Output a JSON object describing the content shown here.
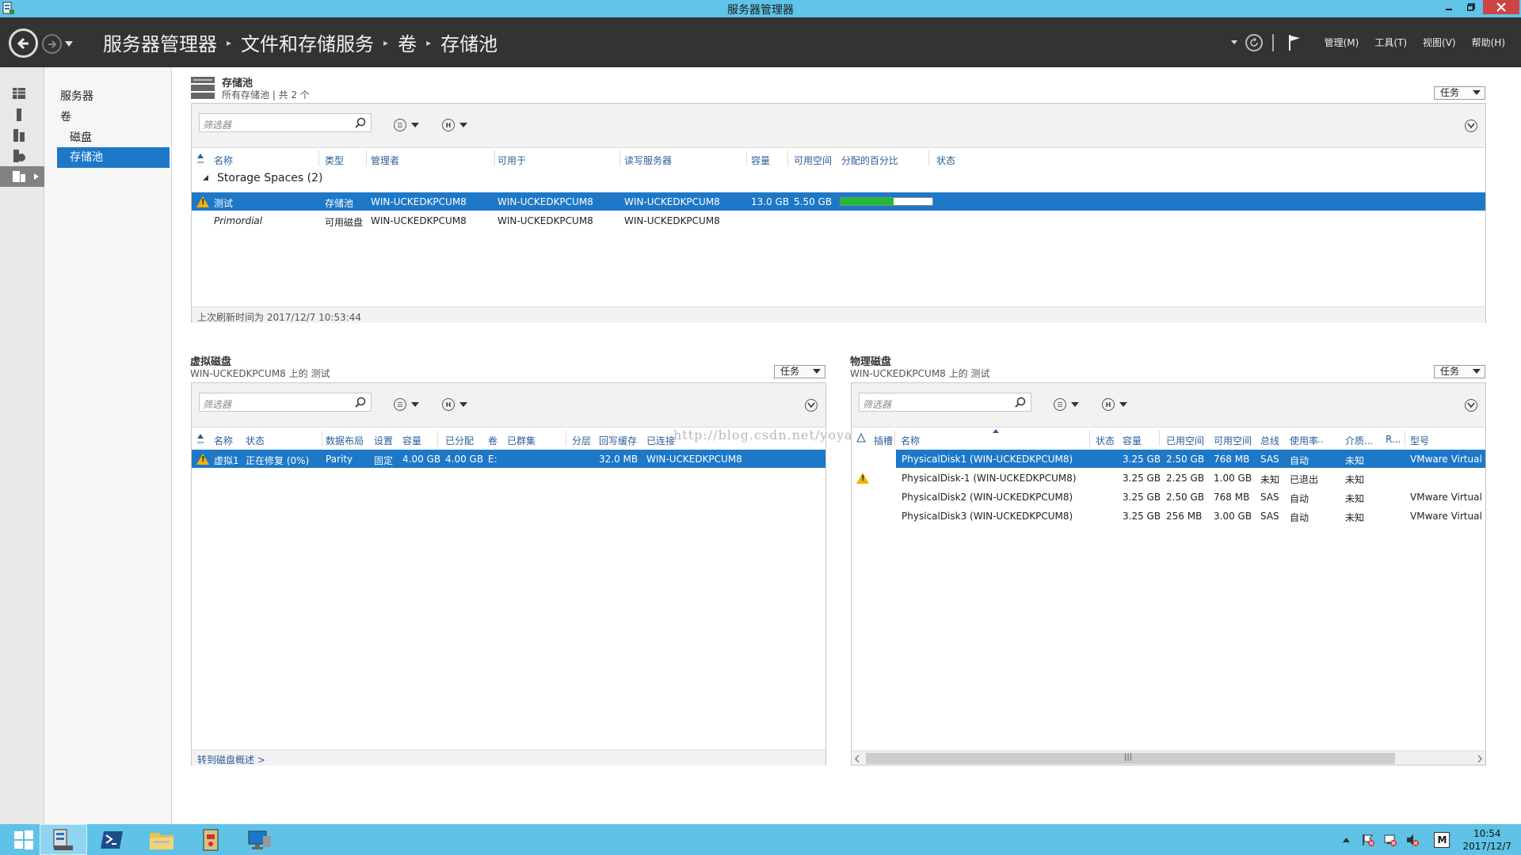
{
  "window": {
    "title": "服务器管理器"
  },
  "nav": {
    "breadcrumb": [
      "服务器管理器",
      "文件和存储服务",
      "卷",
      "存储池"
    ],
    "menus": [
      "管理(M)",
      "工具(T)",
      "视图(V)",
      "帮助(H)"
    ]
  },
  "sidebar": {
    "items": [
      {
        "label": "服务器"
      },
      {
        "label": "卷"
      },
      {
        "label": "磁盘"
      },
      {
        "label": "存储池"
      }
    ]
  },
  "pools": {
    "title": "存储池",
    "subtitle": "所有存储池 | 共 2 个",
    "task_label": "任务",
    "filter_placeholder": "筛选器",
    "columns": [
      "名称",
      "类型",
      "管理者",
      "可用于",
      "读写服务器",
      "容量",
      "可用空间",
      "分配的百分比",
      "状态"
    ],
    "group_label": "Storage Spaces (2)",
    "rows": [
      {
        "name": "测试",
        "type": "存储池",
        "managed_by": "WIN-UCKEDKPCUM8",
        "available_to": "WIN-UCKEDKPCUM8",
        "rw_server": "WIN-UCKEDKPCUM8",
        "capacity": "13.0 GB",
        "free": "5.50 GB",
        "allocated_fraction": 0.58
      },
      {
        "name": "Primordial",
        "type": "可用磁盘",
        "managed_by": "WIN-UCKEDKPCUM8",
        "available_to": "WIN-UCKEDKPCUM8",
        "rw_server": "WIN-UCKEDKPCUM8"
      }
    ],
    "last_refresh": "上次刷新时间为 2017/12/7 10:53:44"
  },
  "vdisks": {
    "title": "虚拟磁盘",
    "subtitle": "WIN-UCKEDKPCUM8 上的 测试",
    "task_label": "任务",
    "filter_placeholder": "筛选器",
    "columns": [
      "名称",
      "状态",
      "数据布局",
      "设置",
      "容量",
      "已分配",
      "卷",
      "已群集",
      "分层",
      "回写缓存",
      "已连接"
    ],
    "rows": [
      {
        "name": "虚拟1",
        "status": "正在修复 (0%)",
        "layout": "Parity",
        "provisioning": "固定",
        "capacity": "4.00 GB",
        "allocated": "4.00 GB",
        "volume": "E:",
        "cache": "32.0 MB",
        "attached": "WIN-UCKEDKPCUM8"
      }
    ],
    "link": "转到磁盘概述 >"
  },
  "pdisks": {
    "title": "物理磁盘",
    "subtitle": "WIN-UCKEDKPCUM8 上的 测试",
    "task_label": "任务",
    "filter_placeholder": "筛选器",
    "columns": [
      "插槽",
      "名称",
      "状态",
      "容量",
      "已用空间",
      "可用空间",
      "总线",
      "使用率",
      "介质...",
      "R...",
      "型号"
    ],
    "rows": [
      {
        "name": "PhysicalDisk1 (WIN-UCKEDKPCUM8)",
        "capacity": "3.25 GB",
        "used": "2.50 GB",
        "free": "768 MB",
        "bus": "SAS",
        "usage": "自动",
        "media": "未知",
        "model": "VMware Virtual S"
      },
      {
        "name": "PhysicalDisk-1 (WIN-UCKEDKPCUM8)",
        "capacity": "3.25 GB",
        "used": "2.25 GB",
        "free": "1.00 GB",
        "bus": "未知",
        "usage": "已退出",
        "media": "未知",
        "model": ""
      },
      {
        "name": "PhysicalDisk2 (WIN-UCKEDKPCUM8)",
        "capacity": "3.25 GB",
        "used": "2.50 GB",
        "free": "768 MB",
        "bus": "SAS",
        "usage": "自动",
        "media": "未知",
        "model": "VMware Virtual S"
      },
      {
        "name": "PhysicalDisk3 (WIN-UCKEDKPCUM8)",
        "capacity": "3.25 GB",
        "used": "256 MB",
        "free": "3.00 GB",
        "bus": "SAS",
        "usage": "自动",
        "media": "未知",
        "model": "VMware Virtual S"
      }
    ]
  },
  "watermark": "http://blog.csdn.net/yoya",
  "taskbar": {
    "time": "10:54",
    "date": "2017/12/7",
    "ime": "M"
  },
  "colors": {
    "selection": "#1e78c8",
    "taskbar": "#5ec3e6",
    "titlebar": "#5fc4e8",
    "header": "#333333",
    "progress": "#22bb33"
  }
}
